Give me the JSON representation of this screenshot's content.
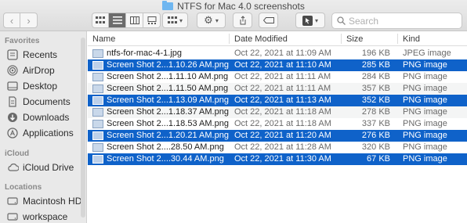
{
  "window": {
    "title": "NTFS for Mac 4.0 screenshots"
  },
  "toolbar": {
    "back_glyph": "‹",
    "forward_glyph": "›",
    "search_placeholder": "Search"
  },
  "sidebar": {
    "sections": [
      {
        "header": "Favorites",
        "items": [
          {
            "label": "Recents",
            "icon": "clock-icon"
          },
          {
            "label": "AirDrop",
            "icon": "airdrop-icon"
          },
          {
            "label": "Desktop",
            "icon": "desktop-icon"
          },
          {
            "label": "Documents",
            "icon": "document-icon"
          },
          {
            "label": "Downloads",
            "icon": "download-icon"
          },
          {
            "label": "Applications",
            "icon": "applications-icon"
          }
        ]
      },
      {
        "header": "iCloud",
        "items": [
          {
            "label": "iCloud Drive",
            "icon": "cloud-icon"
          }
        ]
      },
      {
        "header": "Locations",
        "items": [
          {
            "label": "Macintosh HD",
            "icon": "disk-icon"
          },
          {
            "label": "workspace",
            "icon": "disk-icon"
          }
        ]
      }
    ]
  },
  "columns": {
    "name": "Name",
    "date": "Date Modified",
    "size": "Size",
    "kind": "Kind"
  },
  "files": [
    {
      "name": "ntfs-for-mac-4-1.jpg",
      "date": "Oct 22, 2021 at 11:09 AM",
      "size": "196 KB",
      "kind": "JPEG image",
      "selected": false
    },
    {
      "name": "Screen Shot 2...1.10.26 AM.png",
      "date": "Oct 22, 2021 at 11:10 AM",
      "size": "285 KB",
      "kind": "PNG image",
      "selected": true
    },
    {
      "name": "Screen Shot 2...1.11.10 AM.png",
      "date": "Oct 22, 2021 at 11:11 AM",
      "size": "284 KB",
      "kind": "PNG image",
      "selected": false
    },
    {
      "name": "Screen Shot 2...1.11.50 AM.png",
      "date": "Oct 22, 2021 at 11:11 AM",
      "size": "357 KB",
      "kind": "PNG image",
      "selected": false
    },
    {
      "name": "Screen Shot 2...1.13.09 AM.png",
      "date": "Oct 22, 2021 at 11:13 AM",
      "size": "352 KB",
      "kind": "PNG image",
      "selected": true
    },
    {
      "name": "Screen Shot 2...1.18.37 AM.png",
      "date": "Oct 22, 2021 at 11:18 AM",
      "size": "278 KB",
      "kind": "PNG image",
      "selected": false
    },
    {
      "name": "Screen Shot 2...1.18.53 AM.png",
      "date": "Oct 22, 2021 at 11:18 AM",
      "size": "337 KB",
      "kind": "PNG image",
      "selected": false
    },
    {
      "name": "Screen Shot 2...1.20.21 AM.png",
      "date": "Oct 22, 2021 at 11:20 AM",
      "size": "276 KB",
      "kind": "PNG image",
      "selected": true
    },
    {
      "name": "Screen Shot 2....28.50 AM.png",
      "date": "Oct 22, 2021 at 11:28 AM",
      "size": "320 KB",
      "kind": "PNG image",
      "selected": false
    },
    {
      "name": "Screen Shot 2....30.44 AM.png",
      "date": "Oct 22, 2021 at 11:30 AM",
      "size": "67 KB",
      "kind": "PNG image",
      "selected": true
    }
  ]
}
